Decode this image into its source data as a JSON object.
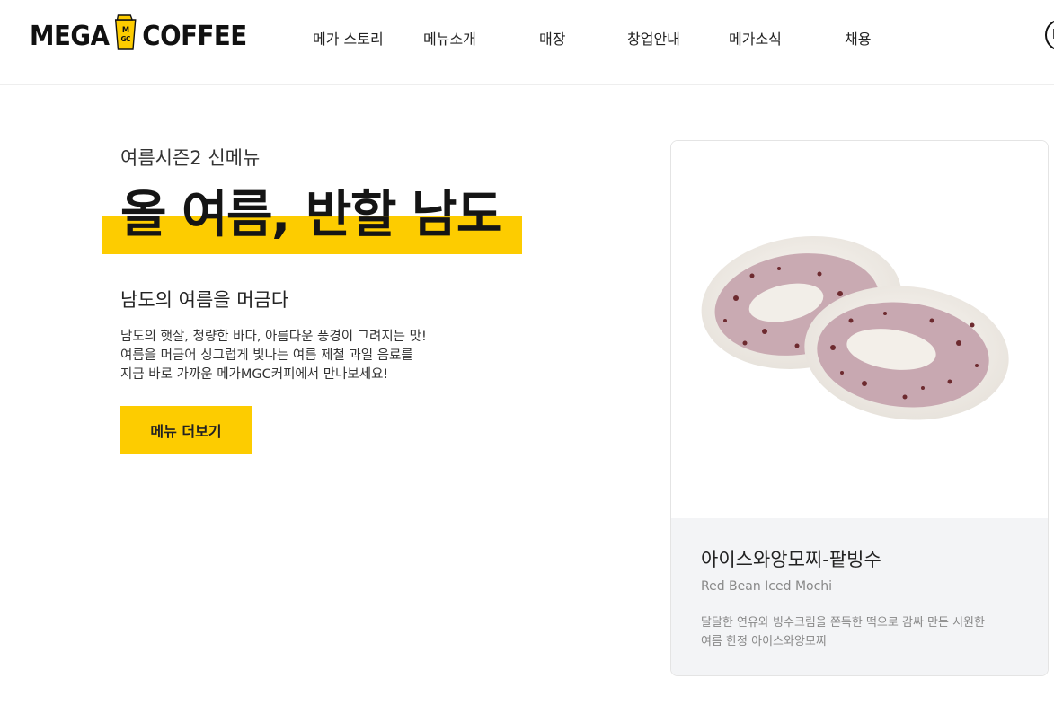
{
  "header": {
    "logo_left": "MEGA",
    "logo_right": "COFFEE",
    "nav": [
      {
        "label": "메가 스토리"
      },
      {
        "label": "메뉴소개"
      },
      {
        "label": "매장"
      },
      {
        "label": "창업안내"
      },
      {
        "label": "메가소식"
      },
      {
        "label": "채용"
      }
    ],
    "profile_text": "b"
  },
  "hero": {
    "kicker": "여름시즌2 신메뉴",
    "headline": "올 여름, 반할 남도",
    "subhead": "남도의 여름을 머금다",
    "description": [
      "남도의 햇살, 청량한 바다, 아름다운 풍경이 그려지는 맛!",
      "여름을 머금어 싱그럽게 빛나는 여름 제철 과일 음료를",
      "지금 바로 가까운 메가MGC커피에서 만나보세요!"
    ],
    "cta_label": "메뉴 더보기"
  },
  "product_card": {
    "title": "아이스와앙모찌-팥빙수",
    "subtitle": "Red Bean Iced Mochi",
    "description": [
      "달달한 연유와 빙수크림을 쫀득한 떡으로 감싸 만든 시원한",
      "여름 한정 아이스와앙모찌"
    ],
    "image": "red-bean-mochi-photo"
  },
  "colors": {
    "brand_yellow": "#fdcc00",
    "card_info_bg": "#f3f4f6",
    "text_dark": "#222222"
  }
}
